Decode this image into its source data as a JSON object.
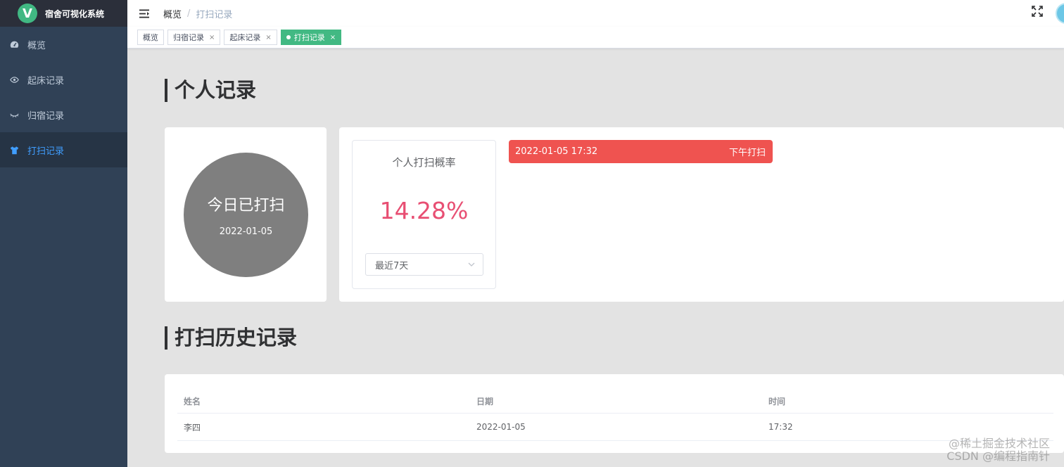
{
  "app": {
    "title": "宿舍可视化系统",
    "logo_letter": "V"
  },
  "sidebar": {
    "items": [
      {
        "label": "概览",
        "icon": "dashboard-icon"
      },
      {
        "label": "起床记录",
        "icon": "eye-icon"
      },
      {
        "label": "归宿记录",
        "icon": "eye-closed-icon"
      },
      {
        "label": "打扫记录",
        "icon": "shirt-icon",
        "active": true
      }
    ]
  },
  "navbar": {
    "breadcrumb": [
      "概览",
      "/",
      "打扫记录"
    ],
    "icons": [
      "hamburger-icon",
      "fullscreen-icon",
      "avatar"
    ]
  },
  "tags": [
    {
      "label": "概览"
    },
    {
      "label": "归宿记录",
      "close": "×"
    },
    {
      "label": "起床记录",
      "close": "×"
    },
    {
      "label": "打扫记录",
      "close": "×",
      "active": true
    }
  ],
  "personal": {
    "heading": "个人记录",
    "status_main": "今日已打扫",
    "status_date": "2022-01-05",
    "rate_title": "个人打扫概率",
    "rate_value": "14.28%",
    "range_select": "最近7天",
    "record": {
      "time": "2022-01-05 17:32",
      "type": "下午打扫"
    }
  },
  "history": {
    "heading": "打扫历史记录",
    "columns": [
      "姓名",
      "日期",
      "时间"
    ],
    "rows": [
      [
        "李四",
        "2022-01-05",
        "17:32"
      ]
    ]
  },
  "watermark": [
    "@稀土掘金技术社区",
    "CSDN @编程指南针"
  ],
  "colors": {
    "sidebar": "#304156",
    "active": "#409eff",
    "tag_active": "#42b983",
    "record_bar": "#ef5350",
    "rate": "#e84f73"
  }
}
